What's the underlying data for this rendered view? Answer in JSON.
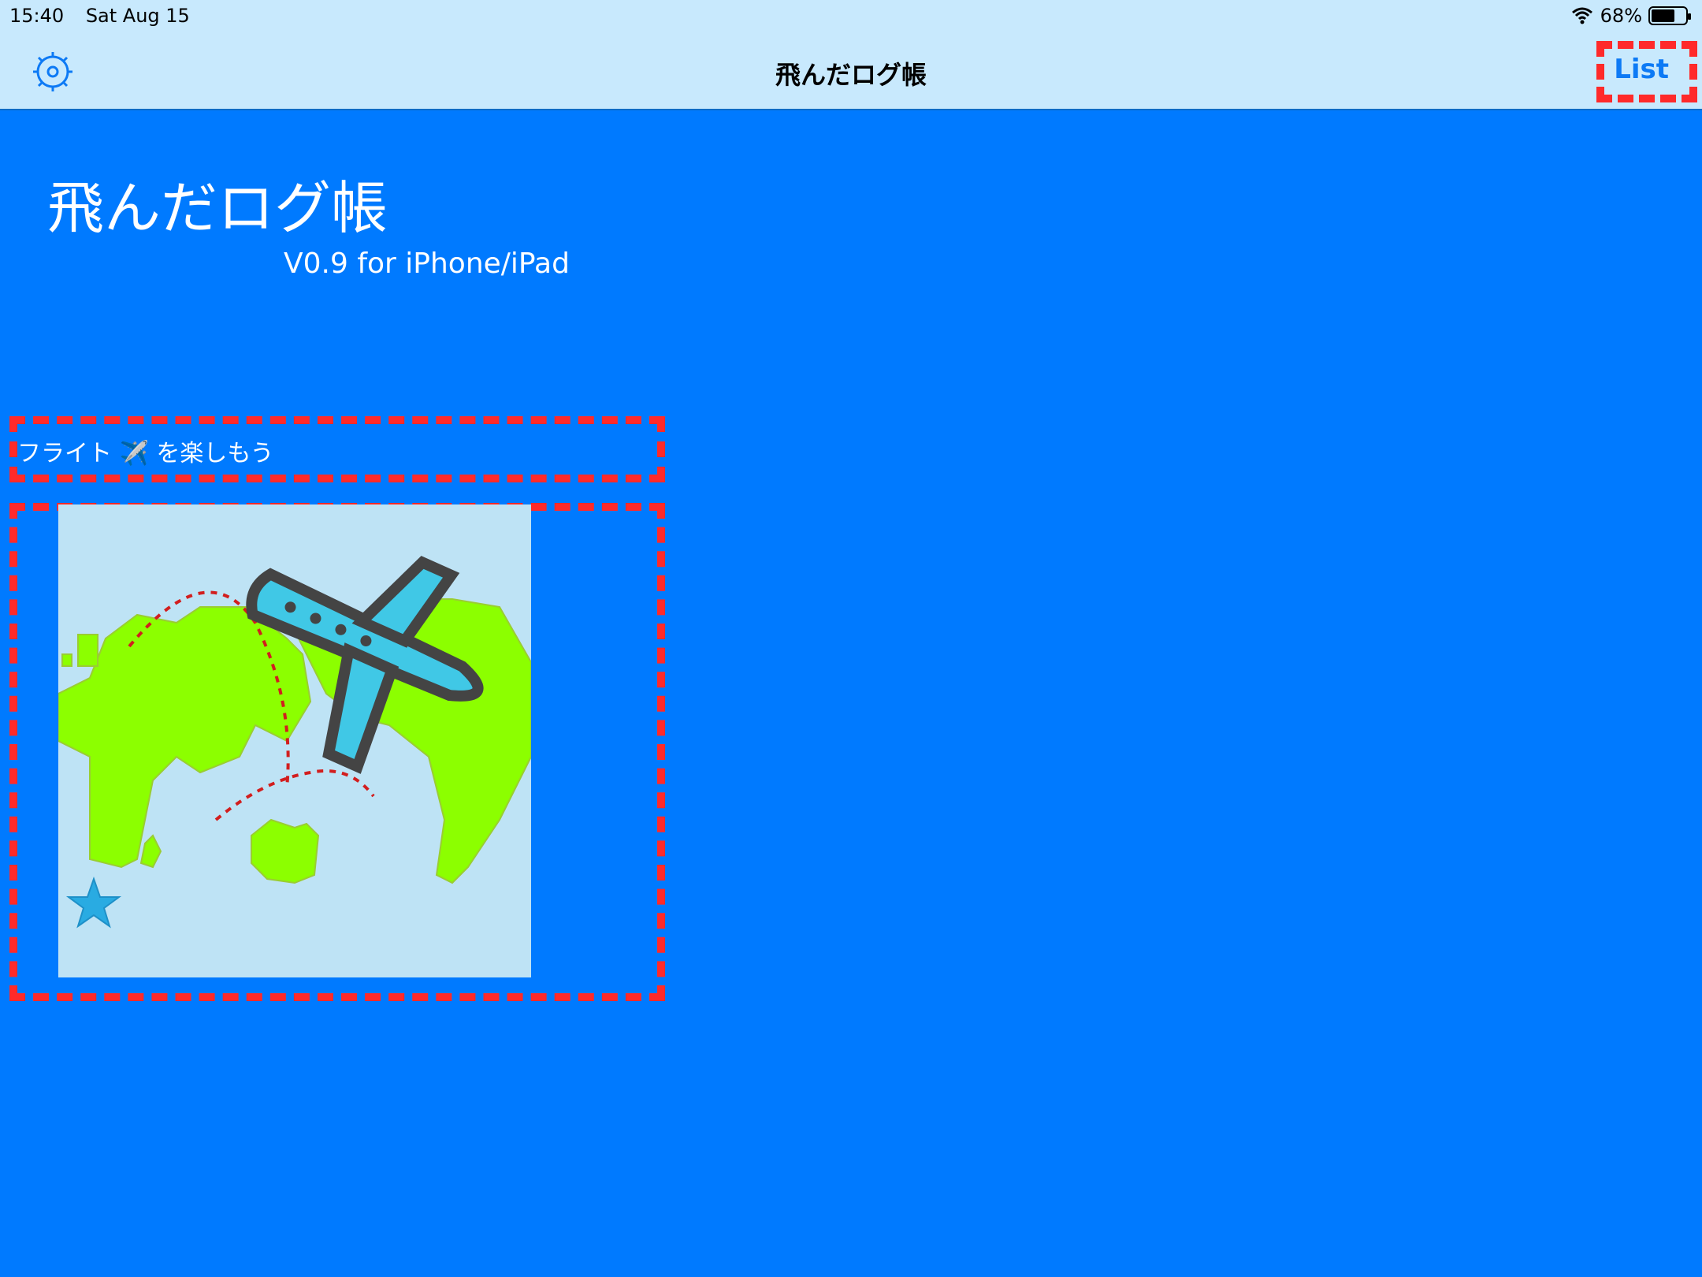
{
  "status": {
    "time": "15:40",
    "date": "Sat Aug 15",
    "battery_percent": "68%",
    "battery_level": 0.68,
    "icons": [
      "wifi-icon",
      "battery-icon"
    ]
  },
  "nav": {
    "title": "飛んだログ帳",
    "list_label": "List",
    "settings_icon": "gear-icon"
  },
  "main": {
    "app_title": "飛んだログ帳",
    "version": "V0.9 for iPhone/iPad",
    "tagline": "フライト ✈️ を楽しもう",
    "map_icon": "world-map-airplane-icon"
  },
  "colors": {
    "background": "#007AFF",
    "bar": "#C8E9FD",
    "accent": "#0D7AF5",
    "highlight": "#FF2A2A"
  }
}
